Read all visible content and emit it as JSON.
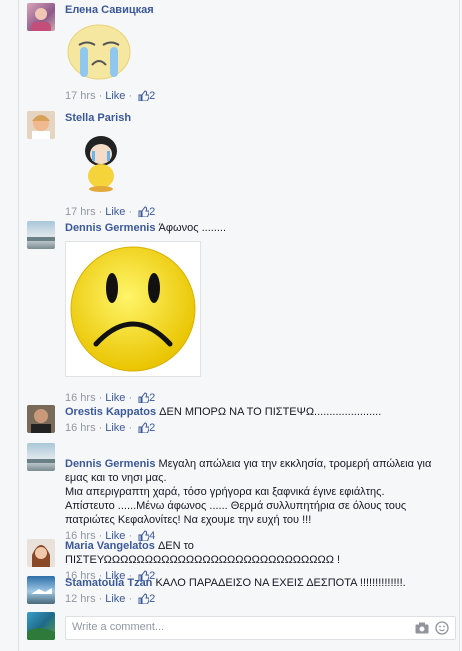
{
  "comments": [
    {
      "name": "Елена Савицкая",
      "text": "",
      "time": "17 hrs",
      "like": "Like",
      "count": "2"
    },
    {
      "name": "Stella Parish",
      "text": "",
      "time": "17 hrs",
      "like": "Like",
      "count": "2"
    },
    {
      "name": "Dennis Germenis",
      "text": "Άφωνος ........",
      "time": "16 hrs",
      "like": "Like",
      "count": "2"
    },
    {
      "name": "Orestis Kappatos",
      "text": "ΔΕΝ ΜΠΟΡΩ ΝΑ ΤΟ ΠΙΣΤΕΨΩ......................",
      "time": "16 hrs",
      "like": "Like",
      "count": "2"
    },
    {
      "name": "Dennis Germenis",
      "text": "Μεγαλη απώλεια για την εκκλησία, τρομερή απώλεια για εμας και το νησι μας.\nΜια απεριγραπτη χαρά, τόσο γρήγορα και ξαφνικά έγινε εφιάλτης.\nΑπίστευτο ......Μένω άφωνος ...... Θερμά συλλυπητήρια σε όλους τους πατριώτες Κεφαλονίτες! Να εχουμε την ευχή του !!!",
      "time": "16 hrs",
      "like": "Like",
      "count": "4"
    },
    {
      "name": "Maria Vangelatos",
      "text": "ΔΕΝ το ΠΙΣΤΕΥΩΩΩΩΩΩΩΩΩΩΩΩΩΩΩΩΩΩΩΩΩΩΩΩΩΩΩΩ !",
      "time": "16 hrs",
      "like": "Like",
      "count": "2"
    },
    {
      "name": "Stamatoula Tzan",
      "text": "ΚΑΛΟ ΠΑΡΑΔΕΙΣΟ ΝΑ ΕΧΕΙΣ ΔΕΣΠΟΤΑ !!!!!!!!!!!!!!.",
      "time": "12 hrs",
      "like": "Like",
      "count": "2"
    }
  ],
  "reply": {
    "placeholder": "Write a comment..."
  },
  "colors": {
    "link": "#3b5998",
    "meta": "#9197a3",
    "smiley": "#f7e31c"
  }
}
